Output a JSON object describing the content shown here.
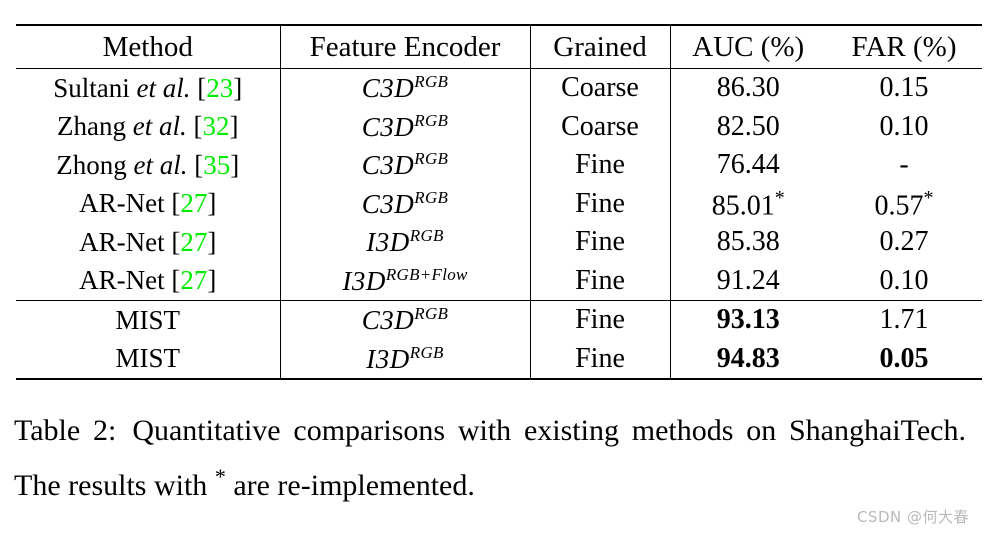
{
  "table": {
    "headers": [
      "Method",
      "Feature Encoder",
      "Grained",
      "AUC (%)",
      "FAR (%)"
    ],
    "rows": [
      {
        "method_name": "Sultani",
        "method_etal": "et al.",
        "method_cite": "23",
        "encoder_base": "C3D",
        "encoder_sup": "RGB",
        "grained": "Coarse",
        "auc": "86.30",
        "auc_star": "",
        "far": "0.15",
        "far_star": "",
        "bold_method": false,
        "bold_auc": false,
        "bold_far": false
      },
      {
        "method_name": "Zhang",
        "method_etal": "et al.",
        "method_cite": "32",
        "encoder_base": "C3D",
        "encoder_sup": "RGB",
        "grained": "Coarse",
        "auc": "82.50",
        "auc_star": "",
        "far": "0.10",
        "far_star": "",
        "bold_method": false,
        "bold_auc": false,
        "bold_far": false
      },
      {
        "method_name": "Zhong",
        "method_etal": "et al.",
        "method_cite": "35",
        "encoder_base": "C3D",
        "encoder_sup": "RGB",
        "grained": "Fine",
        "auc": "76.44",
        "auc_star": "",
        "far": "-",
        "far_star": "",
        "bold_method": false,
        "bold_auc": false,
        "bold_far": false
      },
      {
        "method_name": "AR-Net",
        "method_etal": "",
        "method_cite": "27",
        "encoder_base": "C3D",
        "encoder_sup": "RGB",
        "grained": "Fine",
        "auc": "85.01",
        "auc_star": "*",
        "far": "0.57",
        "far_star": "*",
        "bold_method": false,
        "bold_auc": false,
        "bold_far": false
      },
      {
        "method_name": "AR-Net",
        "method_etal": "",
        "method_cite": "27",
        "encoder_base": "I3D",
        "encoder_sup": "RGB",
        "grained": "Fine",
        "auc": "85.38",
        "auc_star": "",
        "far": "0.27",
        "far_star": "",
        "bold_method": false,
        "bold_auc": false,
        "bold_far": false
      },
      {
        "method_name": "AR-Net",
        "method_etal": "",
        "method_cite": "27",
        "encoder_base": "I3D",
        "encoder_sup": "RGB+Flow",
        "grained": "Fine",
        "auc": "91.24",
        "auc_star": "",
        "far": "0.10",
        "far_star": "",
        "bold_method": false,
        "bold_auc": false,
        "bold_far": false
      }
    ],
    "highlight_rows": [
      {
        "method_name": "MIST",
        "method_etal": "",
        "method_cite": "",
        "encoder_base": "C3D",
        "encoder_sup": "RGB",
        "grained": "Fine",
        "auc": "93.13",
        "auc_star": "",
        "far": "1.71",
        "far_star": "",
        "bold_method": true,
        "bold_auc": true,
        "bold_far": false
      },
      {
        "method_name": "MIST",
        "method_etal": "",
        "method_cite": "",
        "encoder_base": "I3D",
        "encoder_sup": "RGB",
        "grained": "Fine",
        "auc": "94.83",
        "auc_star": "",
        "far": "0.05",
        "far_star": "",
        "bold_method": true,
        "bold_auc": true,
        "bold_far": true
      }
    ]
  },
  "caption": {
    "label": "Table 2:",
    "text_before_star": "Quantitative comparisons with existing methods on ShanghaiTech. The results with",
    "star": "*",
    "text_after_star": "are re-implemented.",
    "full": "Table 2: Quantitative comparisons with existing methods on ShanghaiTech. The results with * are re-implemented."
  },
  "watermark": {
    "text": "CSDN @何大春"
  },
  "colors": {
    "citation_green": "#00ec00",
    "rule_black": "#000000",
    "watermark_grey": "#b9b9b9",
    "page_background": "#ffffff"
  }
}
